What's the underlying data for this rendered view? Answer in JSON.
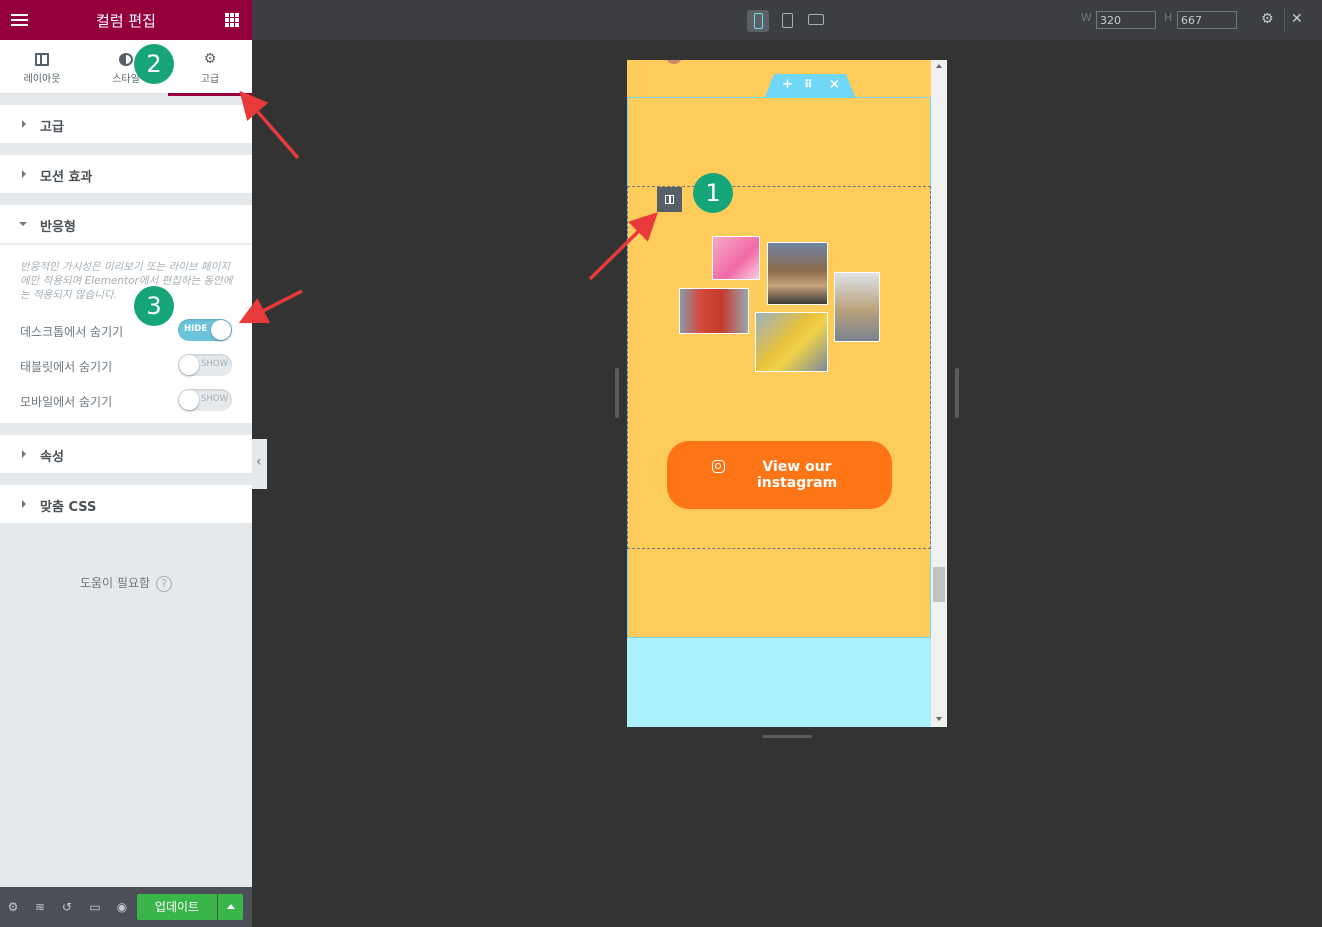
{
  "panel": {
    "title": "컬럼 편집",
    "tabs": [
      {
        "label": "레이아웃",
        "icon": "layout-icon"
      },
      {
        "label": "스타일",
        "icon": "style-icon"
      },
      {
        "label": "고급",
        "icon": "gear-icon",
        "active": true
      }
    ],
    "sections": {
      "advanced": "고급",
      "motion": "모션 효과",
      "responsive": "반응형",
      "attributes": "속성",
      "custom_css": "맞춤 CSS"
    },
    "responsive": {
      "description": "반응적인 가시성은 미리보기 또는 라이브 페이지에만 적용되며 Elementor에서 편집하는 동안에는 적용되지 않습니다.",
      "controls": [
        {
          "label": "데스크톱에서 숨기기",
          "state": "HIDE",
          "on": true
        },
        {
          "label": "태블릿에서 숨기기",
          "state": "SHOW",
          "on": false
        },
        {
          "label": "모바일에서 숨기기",
          "state": "SHOW",
          "on": false
        }
      ]
    },
    "help": "도움이 필요함",
    "help_icon": "?",
    "footer": {
      "update_label": "업데이트",
      "icons": [
        "settings-icon",
        "layers-icon",
        "history-icon",
        "responsive-icon",
        "preview-eye-icon"
      ]
    },
    "accent_color": "#93003c"
  },
  "topbar": {
    "width_label": "W",
    "width_value": "320",
    "height_label": "H",
    "height_value": "667",
    "active_device": "mobile"
  },
  "preview": {
    "button_text": "View our instagram",
    "background_color": "#fecc5a",
    "button_color": "#fe7518",
    "bottom_band_color": "#abf0fa"
  },
  "annotations": {
    "badges": [
      "1",
      "2",
      "3"
    ],
    "color": "#16a579"
  }
}
